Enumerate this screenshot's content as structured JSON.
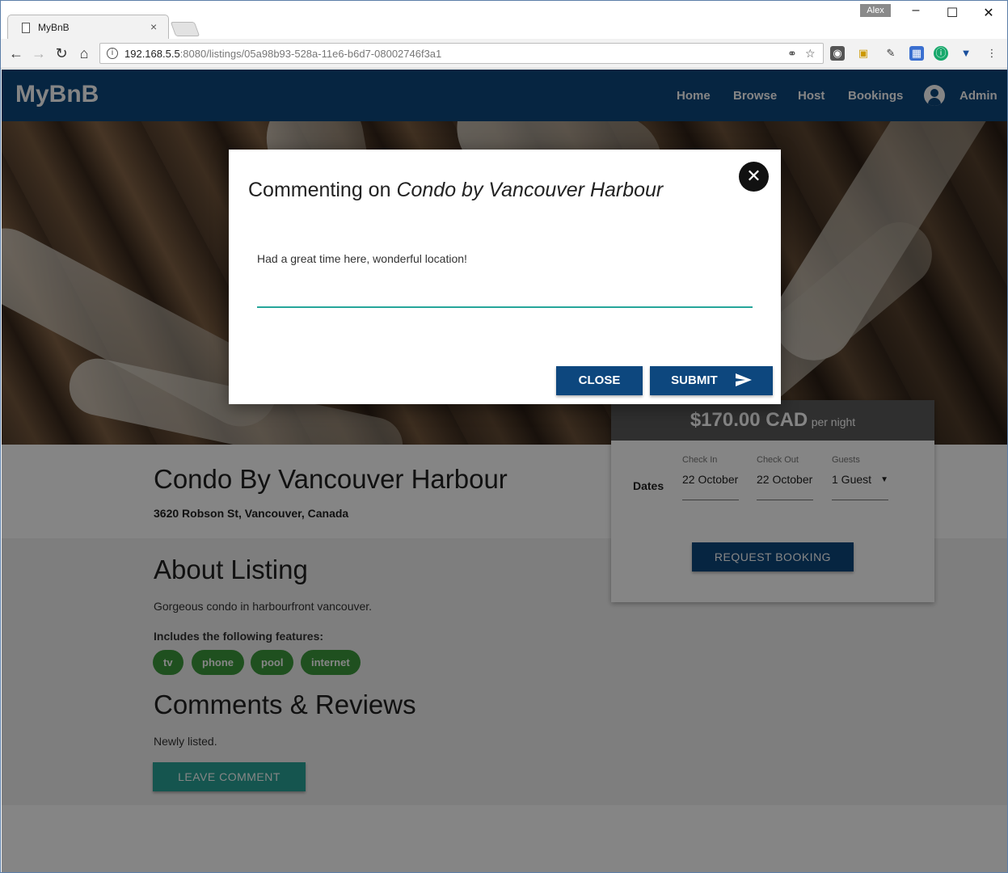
{
  "browser": {
    "tab_title": "MyBnB",
    "tab_close": "×",
    "user": "Alex",
    "url_host": "192.168.5.5",
    "url_rest": ":8080/listings/05a98b93-528a-11e6-b6d7-08002746f3a1",
    "info_glyph": "i"
  },
  "navbar": {
    "brand": "MyBnB",
    "links": [
      "Home",
      "Browse",
      "Host",
      "Bookings"
    ],
    "admin": "Admin"
  },
  "listing": {
    "title": "Condo By Vancouver Harbour",
    "address": "3620 Robson St, Vancouver, Canada",
    "about_heading": "About Listing",
    "description": "Gorgeous condo in harbourfront vancouver.",
    "features_label": "Includes the following features:",
    "features": [
      "tv",
      "phone",
      "pool",
      "internet"
    ],
    "comments_heading": "Comments & Reviews",
    "comments_status": "Newly listed.",
    "leave_comment": "LEAVE COMMENT"
  },
  "booking": {
    "price": "$170.00 CAD",
    "per_night": "per night",
    "dates_label": "Dates",
    "check_in_label": "Check In",
    "check_in_value": "22 October",
    "check_out_label": "Check Out",
    "check_out_value": "22 October",
    "guests_label": "Guests",
    "guests_value": "1 Guest",
    "request": "REQUEST BOOKING"
  },
  "modal": {
    "title_prefix": "Commenting on ",
    "title_listing": "Condo by Vancouver Harbour",
    "comment_value": "Had a great time here, wonderful location!",
    "close_label": "CLOSE",
    "submit_label": "SUBMIT"
  },
  "colors": {
    "navbar": "#0d477e",
    "accent_teal": "#26a69a",
    "chip_green": "#3c9a3c"
  }
}
